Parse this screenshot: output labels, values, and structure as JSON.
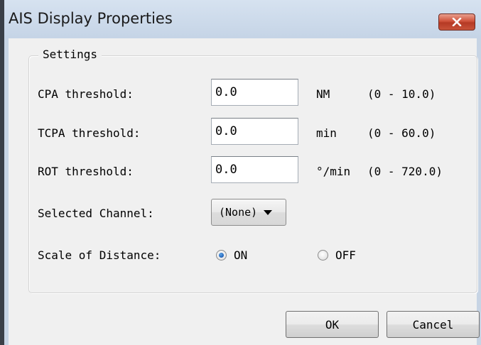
{
  "window": {
    "title": "AIS Display Properties",
    "close_icon": "close-x-icon"
  },
  "settings": {
    "group_label": "Settings",
    "rows": [
      {
        "label": "CPA threshold:",
        "value": "0.0",
        "unit": "NM",
        "range": "(0 - 10.0)"
      },
      {
        "label": "TCPA threshold:",
        "value": "0.0",
        "unit": "min",
        "range": "(0 - 60.0)"
      },
      {
        "label": "ROT threshold:",
        "value": "0.0",
        "unit": "°/min",
        "range": "(0 - 720.0)"
      }
    ],
    "channel": {
      "label": "Selected Channel:",
      "value": "(None)",
      "icon": "chevron-down-icon"
    },
    "scale": {
      "label": "Scale of Distance:",
      "options": [
        {
          "label": "ON",
          "selected": true
        },
        {
          "label": "OFF",
          "selected": false
        }
      ]
    }
  },
  "buttons": {
    "ok": "OK",
    "cancel": "Cancel"
  },
  "colors": {
    "titlebar": "#c7d4e4",
    "client": "#f0f0f0",
    "close_button": "#c8533a",
    "radio_selected": "#1e5fb5"
  }
}
